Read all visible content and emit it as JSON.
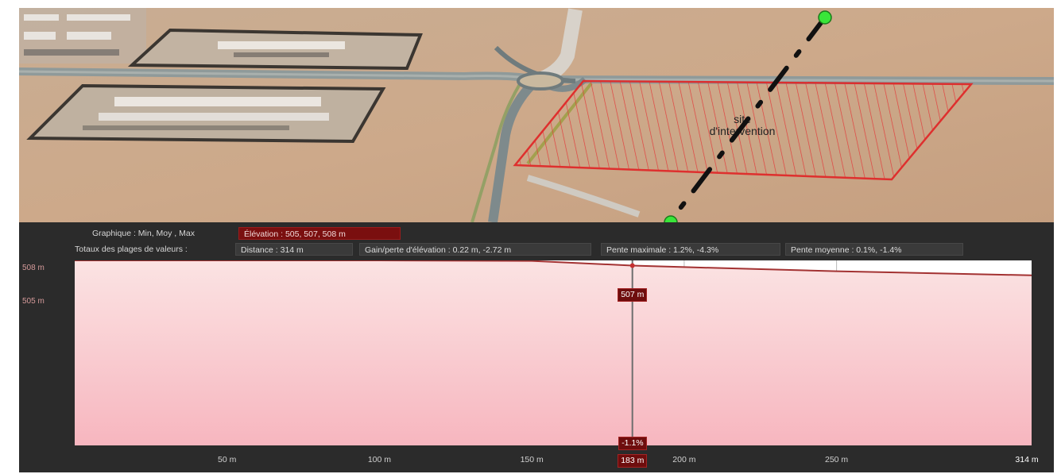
{
  "map": {
    "site_label_line1": "site",
    "site_label_line2": "d'intervention",
    "colors": {
      "ground": "#c9a888",
      "road": "#8e9898",
      "site_outline": "#e02a2a",
      "profile_line": "#111111",
      "endpoint": "#39e639"
    }
  },
  "profile": {
    "graph_label": "Graphique : Min, Moy , Max",
    "elevation_stat": "Élévation : 505, 507, 508 m",
    "totals_label": "Totaux des plages de valeurs :",
    "distance_stat": "Distance : 314 m",
    "gain_loss_stat": "Gain/perte d'élévation : 0.22 m, -2.72 m",
    "max_slope_stat": "Pente maximale : 1.2%, -4.3%",
    "avg_slope_stat": "Pente moyenne : 0.1%, -1.4%",
    "y_labels": [
      "508 m",
      "505 m"
    ],
    "x_ticks": [
      "50 m",
      "100 m",
      "150 m",
      "200 m",
      "250 m",
      "314 m"
    ],
    "cursor_elevation": "507 m",
    "cursor_slope": "-1.1%",
    "cursor_distance": "183 m"
  },
  "chart_data": {
    "type": "area",
    "title": "",
    "xlabel": "",
    "ylabel": "",
    "x_unit": "m",
    "y_unit": "m",
    "xlim": [
      0,
      314
    ],
    "ylim": [
      472,
      508
    ],
    "x": [
      0,
      50,
      100,
      150,
      183,
      200,
      250,
      314
    ],
    "y": [
      508.0,
      508.0,
      508.0,
      507.9,
      507.0,
      506.7,
      505.9,
      505.1
    ],
    "y_tick_labels": [
      "508 m",
      "505 m"
    ],
    "x_tick_labels": [
      "50 m",
      "100 m",
      "150 m",
      "200 m",
      "250 m",
      "314 m"
    ],
    "cursor": {
      "x": 183,
      "elevation": "507 m",
      "slope": "-1.1%"
    },
    "grid": true,
    "colors": {
      "line": "#a33232",
      "fill_top": "#f8d7d7",
      "fill_bottom": "#f7b8c0"
    }
  }
}
